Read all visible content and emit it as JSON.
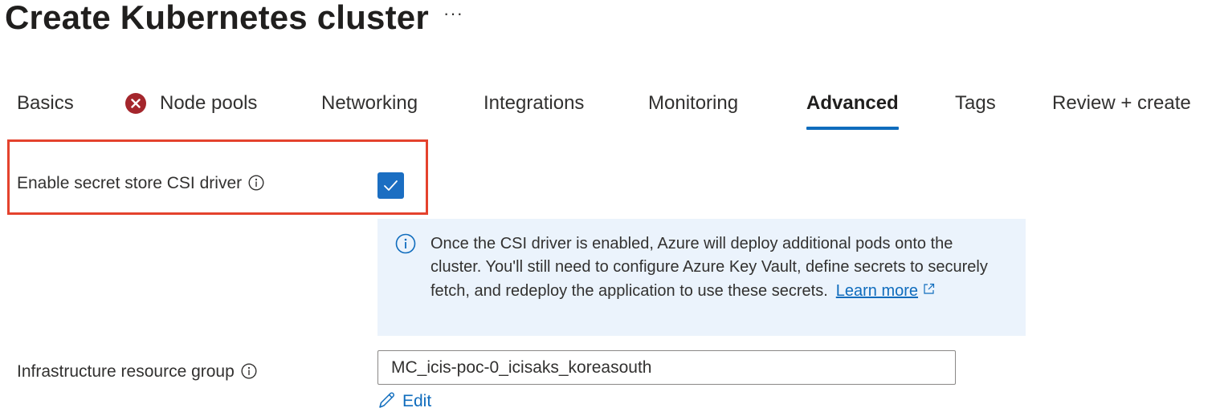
{
  "page": {
    "title": "Create Kubernetes cluster",
    "more_label": "···"
  },
  "tabs": [
    {
      "label": "Basics",
      "active": false,
      "error": false
    },
    {
      "label": "Node pools",
      "active": false,
      "error": true
    },
    {
      "label": "Networking",
      "active": false,
      "error": false
    },
    {
      "label": "Integrations",
      "active": false,
      "error": false
    },
    {
      "label": "Monitoring",
      "active": false,
      "error": false
    },
    {
      "label": "Advanced",
      "active": true,
      "error": false
    },
    {
      "label": "Tags",
      "active": false,
      "error": false
    },
    {
      "label": "Review + create",
      "active": false,
      "error": false
    }
  ],
  "csi_driver": {
    "label": "Enable secret store CSI driver",
    "checked": true
  },
  "info_banner": {
    "text": "Once the CSI driver is enabled, Azure will deploy additional pods onto the cluster. You'll still need to configure Azure Key Vault, define secrets to securely fetch, and redeploy the application to use these secrets.",
    "link_label": "Learn more"
  },
  "infra_rg": {
    "label": "Infrastructure resource group",
    "value": "MC_icis-poc-0_icisaks_koreasouth",
    "edit_label": "Edit"
  },
  "colors": {
    "accent": "#0f6cbd",
    "checkbox": "#1b6ec2",
    "error": "#a4262c",
    "highlight": "#e4422d",
    "banner_bg": "#ebf3fc"
  },
  "icons": {
    "error": "error-circle-icon",
    "info": "info-icon",
    "external": "external-link-icon",
    "edit": "pencil-icon",
    "check": "checkmark-icon"
  }
}
